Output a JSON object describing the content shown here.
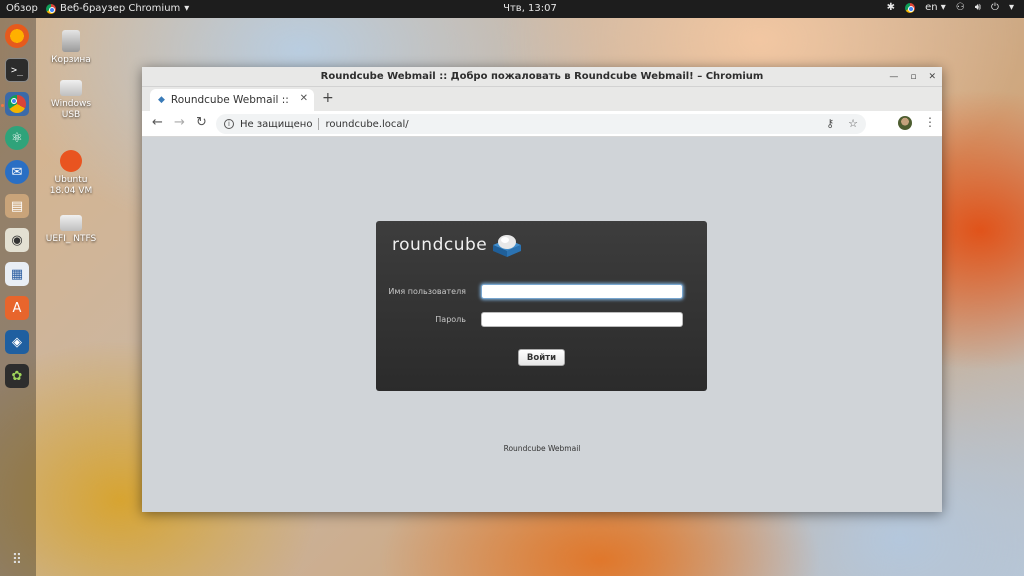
{
  "topbar": {
    "overview": "Обзор",
    "app_menu": "Веб-браузер Chromium",
    "clock": "Чтв, 13:07",
    "language": "en"
  },
  "desktop_icons": [
    {
      "label": "Корзина"
    },
    {
      "label": "Windows USB"
    },
    {
      "label": "Ubuntu 18.04 VM"
    },
    {
      "label": "UEFI_ NTFS"
    }
  ],
  "window": {
    "title": "Roundcube Webmail :: Добро пожаловать в Roundcube Webmail! – Chromium",
    "tab_title": "Roundcube Webmail :: Добро пожаловать в Roundcube Webmail!",
    "security_label": "Не защищено",
    "url": "roundcube.local/"
  },
  "login": {
    "brand": "roundcube",
    "username_label": "Имя пользователя",
    "password_label": "Пароль",
    "username_value": "",
    "password_value": "",
    "submit_label": "Войти"
  },
  "footer": "Roundcube Webmail"
}
